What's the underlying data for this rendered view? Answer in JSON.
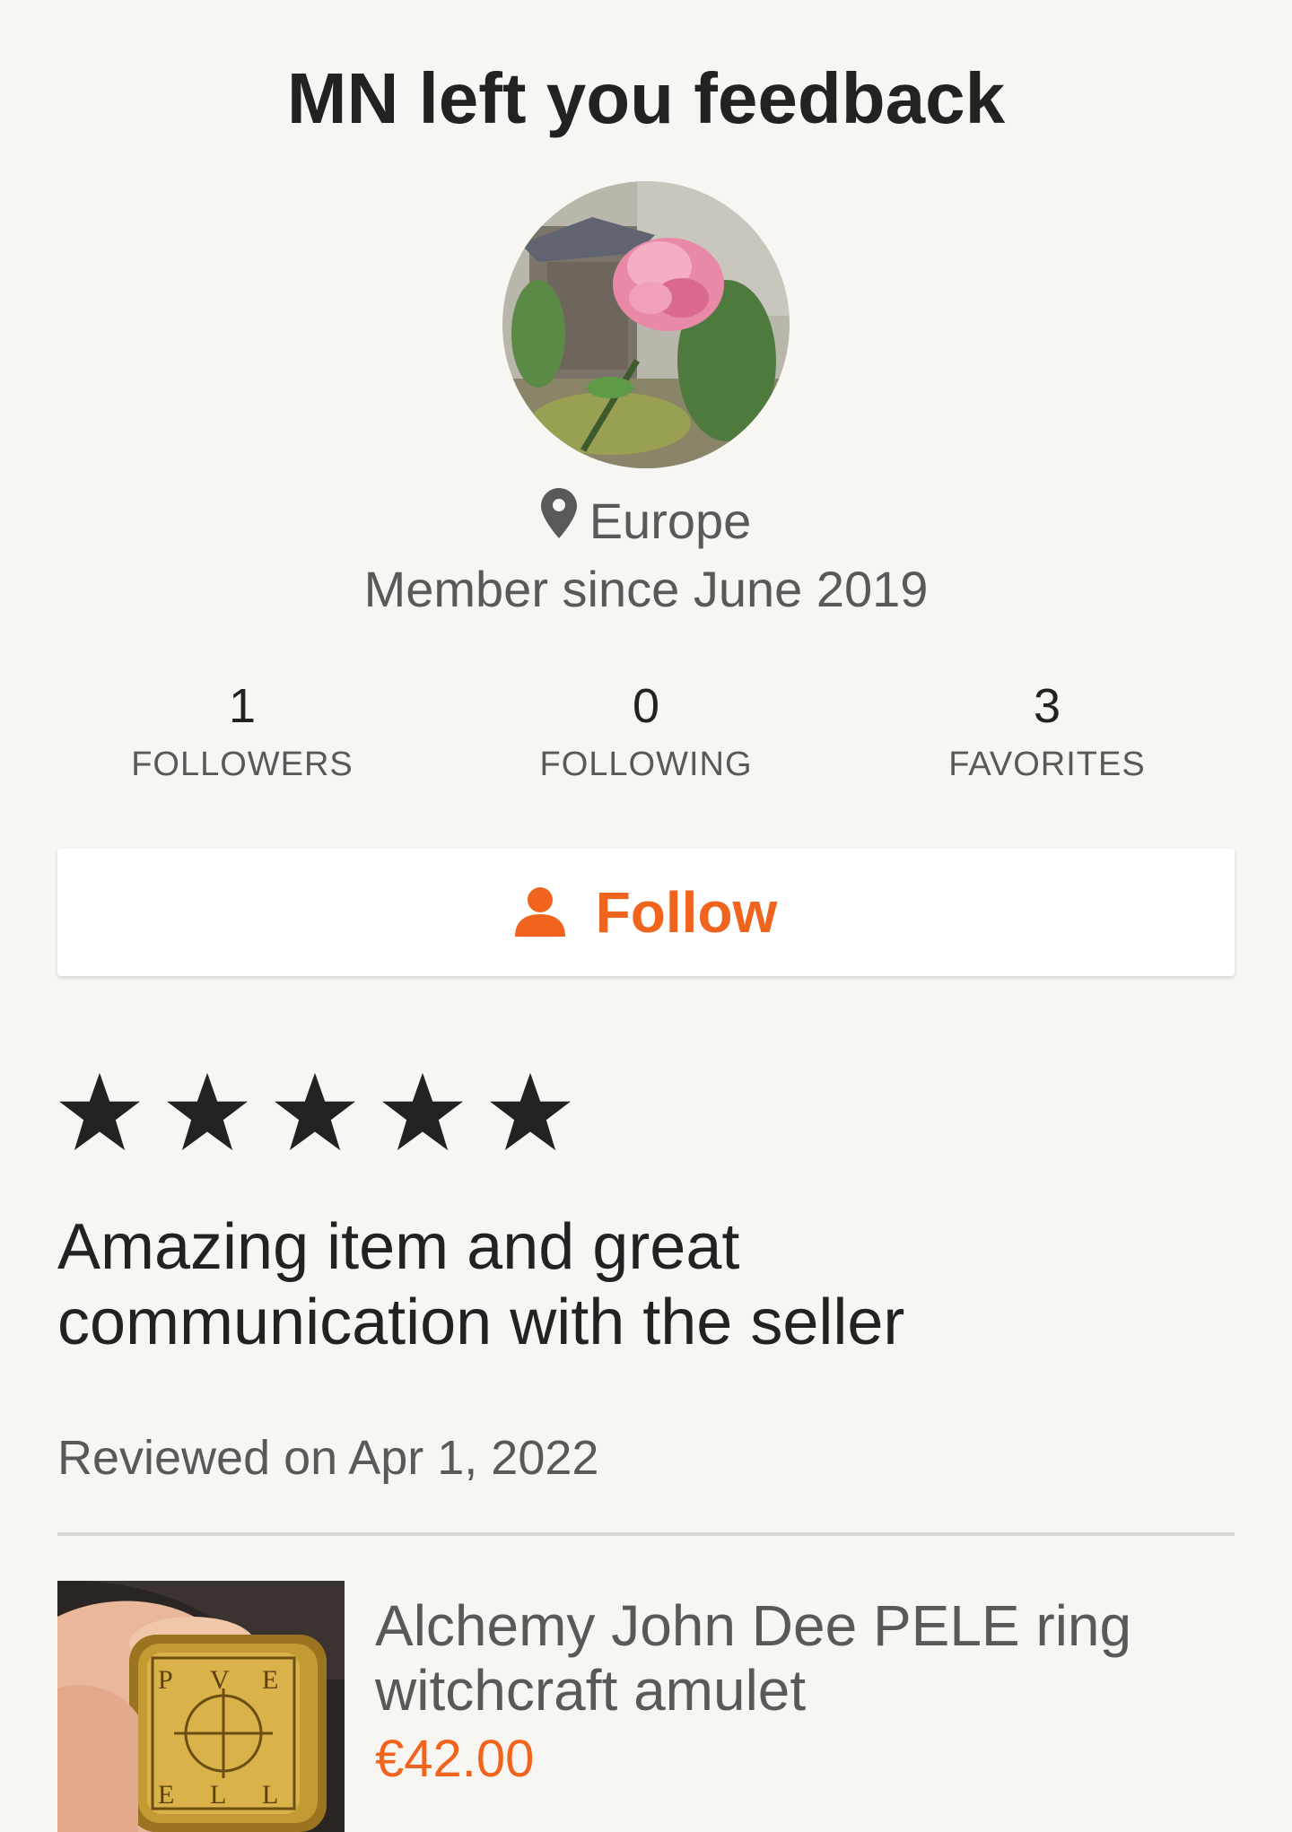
{
  "header": {
    "title": "MN left you feedback"
  },
  "profile": {
    "location": "Europe",
    "member_since": "Member since June 2019",
    "stats": [
      {
        "value": "1",
        "label": "FOLLOWERS"
      },
      {
        "value": "0",
        "label": "FOLLOWING"
      },
      {
        "value": "3",
        "label": "FAVORITES"
      }
    ]
  },
  "follow_button": {
    "label": "Follow",
    "icon": "person-icon"
  },
  "review": {
    "rating": 5,
    "rating_max": 5,
    "text": "Amazing item and great communication with the seller",
    "date": "Reviewed on Apr 1, 2022"
  },
  "listing": {
    "title": "Alchemy John Dee PELE ring witchcraft amulet",
    "price": "€42.00",
    "image_engraving": [
      "P",
      "V",
      "E",
      "E",
      "L",
      "L"
    ]
  },
  "colors": {
    "accent": "#f1641e",
    "background": "#f7f6f3",
    "text_primary": "#222222",
    "text_secondary": "#595959"
  }
}
